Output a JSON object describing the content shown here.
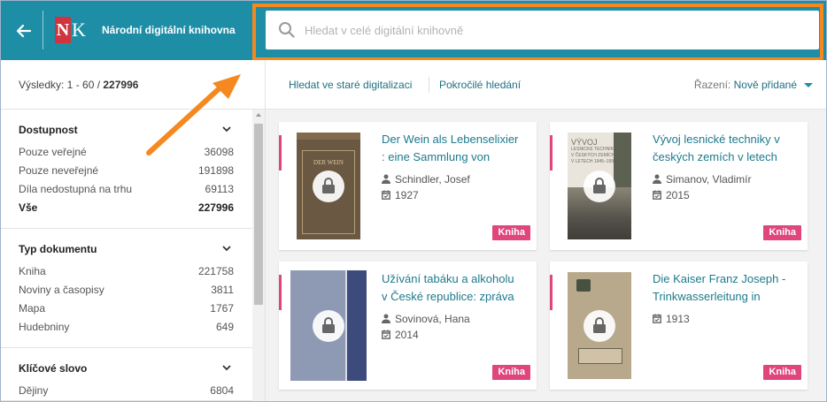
{
  "header": {
    "brand": "Národní digitální knihovna",
    "logo_letters": [
      "N",
      "K"
    ],
    "search": {
      "placeholder": "Hledat v celé digitální knihovně"
    }
  },
  "left": {
    "results_prefix": "Výsledky: 1 - 60 / ",
    "results_total": "227996",
    "facets": [
      {
        "title": "Dostupnost",
        "rows": [
          {
            "label": "Pouze veřejné",
            "count": "36098",
            "bold": false
          },
          {
            "label": "Pouze neveřejné",
            "count": "191898",
            "bold": false
          },
          {
            "label": "Díla nedostupná na trhu",
            "count": "69113",
            "bold": false
          },
          {
            "label": "Vše",
            "count": "227996",
            "bold": true
          }
        ]
      },
      {
        "title": "Typ dokumentu",
        "rows": [
          {
            "label": "Kniha",
            "count": "221758"
          },
          {
            "label": "Noviny a časopisy",
            "count": "3811"
          },
          {
            "label": "Mapa",
            "count": "1767"
          },
          {
            "label": "Hudebniny",
            "count": "649"
          }
        ]
      },
      {
        "title": "Klíčové slovo",
        "rows": [
          {
            "label": "Dějiny",
            "count": "6804"
          }
        ]
      }
    ]
  },
  "toolbar": {
    "old_digitization": "Hledat ve staré digitalizaci",
    "advanced": "Pokročilé hledání",
    "sort_label": "Řazení: ",
    "sort_value": "Nově přidané"
  },
  "cards": [
    {
      "title_l1": "Der Wein als Lebenselixier",
      "title_l2": ": eine Sammlung von",
      "author": "Schindler, Josef",
      "year": "1927",
      "badge": "Kniha",
      "cover_text": [
        "DER WEIN"
      ]
    },
    {
      "title_l1": "Vývoj lesnické techniky v",
      "title_l2": "českých zemích v letech",
      "author": "Simanov, Vladimír",
      "year": "2015",
      "badge": "Kniha",
      "cover_text": [
        "VÝVOJ",
        "LESNICKÉ TECHNIKY",
        "V ČESKÝCH ZEMÍCH",
        "V LETECH 1945–1992"
      ]
    },
    {
      "title_l1": "Užívání tabáku a alkoholu",
      "title_l2": "v České republice: zpráva",
      "author": "Sovinová, Hana",
      "year": "2014",
      "badge": "Kniha",
      "cover_text": []
    },
    {
      "title_l1": "Die Kaiser Franz Joseph -",
      "title_l2": "Trinkwasserleitung in",
      "author": "",
      "year": "1913",
      "badge": "Kniha",
      "cover_text": []
    }
  ],
  "colors": {
    "header_bg": "#1d8ea6",
    "annotation": "#f5881f",
    "badge": "#e0457b",
    "link": "#1d7a8c"
  }
}
